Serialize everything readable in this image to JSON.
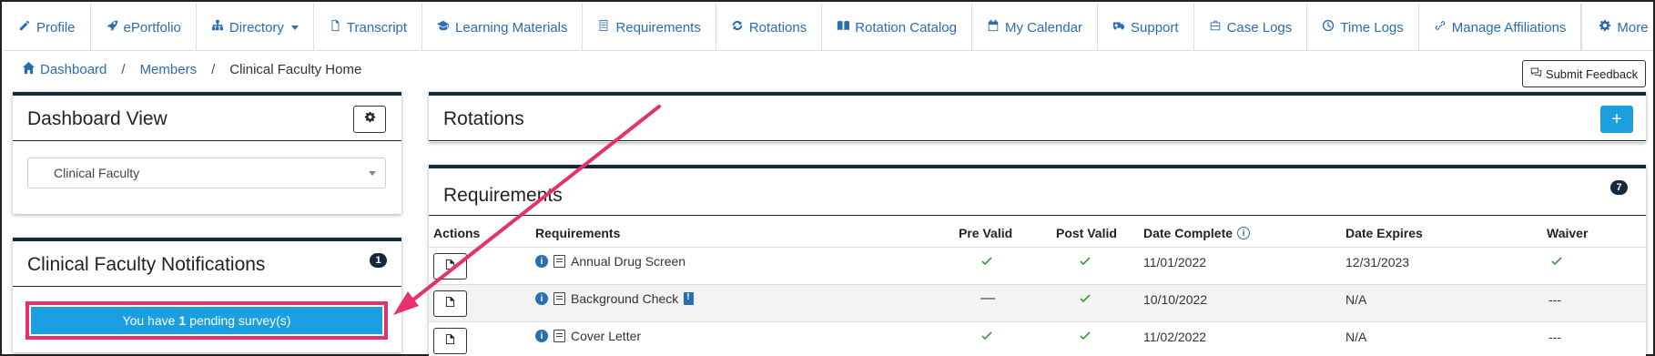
{
  "nav": {
    "items": [
      {
        "label": "Profile",
        "icon": "pencil-icon"
      },
      {
        "label": "ePortfolio",
        "icon": "rocket-icon"
      },
      {
        "label": "Directory",
        "icon": "sitemap-icon",
        "dropdown": true
      },
      {
        "label": "Transcript",
        "icon": "file-icon"
      },
      {
        "label": "Learning Materials",
        "icon": "graduation-cap-icon"
      },
      {
        "label": "Requirements",
        "icon": "list-icon"
      },
      {
        "label": "Rotations",
        "icon": "refresh-icon"
      },
      {
        "label": "Rotation Catalog",
        "icon": "book-open-icon"
      },
      {
        "label": "My Calendar",
        "icon": "calendar-icon"
      },
      {
        "label": "Support",
        "icon": "ambulance-icon"
      },
      {
        "label": "Case Logs",
        "icon": "briefcase-icon"
      },
      {
        "label": "Time Logs",
        "icon": "clock-icon"
      },
      {
        "label": "Manage Affiliations",
        "icon": "link-icon"
      }
    ],
    "more_label": "More"
  },
  "breadcrumb": {
    "items": [
      "Dashboard",
      "Members"
    ],
    "current": "Clinical Faculty Home"
  },
  "feedback_label": "Submit Feedback",
  "dashboard_view": {
    "title": "Dashboard View",
    "selected": "Clinical Faculty"
  },
  "notifications": {
    "title": "Clinical Faculty Notifications",
    "count": "1",
    "survey_prefix": "You have",
    "survey_count": "1",
    "survey_suffix": "pending survey(s)"
  },
  "rotations": {
    "title": "Rotations",
    "add_label": "+"
  },
  "requirements": {
    "title": "Requirements",
    "count": "7",
    "columns": [
      "Actions",
      "Requirements",
      "Pre Valid",
      "Post Valid",
      "Date Complete",
      "Date Expires",
      "Waiver"
    ],
    "rows": [
      {
        "name": "Annual Drug Screen",
        "pre": "check",
        "post": "check",
        "date_complete": "11/01/2022",
        "date_expires": "12/31/2023",
        "waiver": "check"
      },
      {
        "name": "Background Check",
        "pre": "—",
        "post": "check",
        "date_complete": "10/10/2022",
        "date_expires": "N/A",
        "waiver": "---"
      },
      {
        "name": "Cover Letter",
        "pre": "check",
        "post": "check",
        "date_complete": "11/02/2022",
        "date_expires": "N/A",
        "waiver": "---"
      }
    ]
  },
  "colors": {
    "link": "#2a6db0",
    "panel_border": "#16283c",
    "primary_button": "#1a9fe0",
    "highlight": "#e5336a",
    "check": "#3a9a3a"
  }
}
